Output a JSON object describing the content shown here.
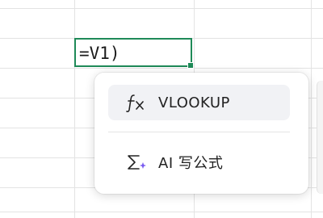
{
  "cell": {
    "formula": "=V1)"
  },
  "popup": {
    "items": [
      {
        "label": "VLOOKUP",
        "icon": "function-fx-icon"
      },
      {
        "label": "AI 写公式",
        "icon": "sigma-sparkle-icon"
      }
    ]
  },
  "colors": {
    "accent": "#1f8a58",
    "highlight": "#f1f2f5",
    "sparkle": "#7a5cf0"
  }
}
